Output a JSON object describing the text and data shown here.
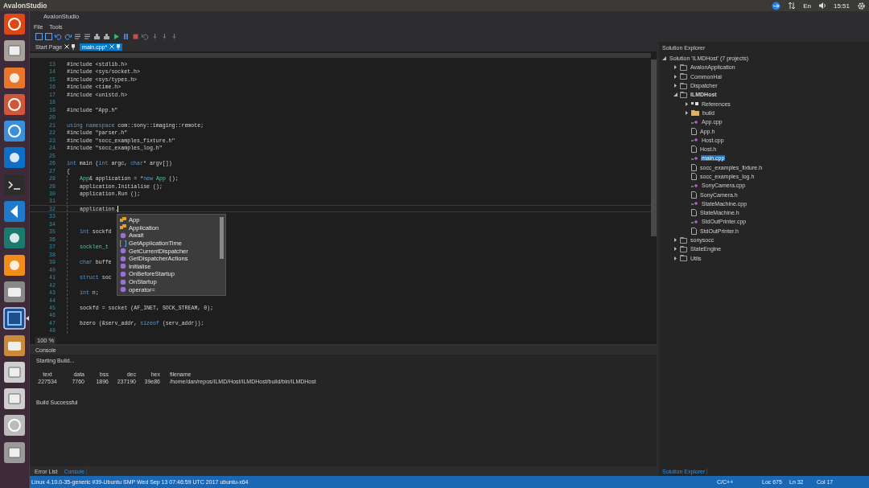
{
  "system_bar": {
    "title": "AvalonStudio",
    "language": "En",
    "time": "15:51"
  },
  "launcher": [
    {
      "kind": "ubuntu",
      "selected": false
    },
    {
      "kind": "files",
      "selected": false
    },
    {
      "kind": "store",
      "selected": false
    },
    {
      "kind": "settings",
      "selected": false
    },
    {
      "kind": "browser",
      "selected": false
    },
    {
      "kind": "remote",
      "selected": false
    },
    {
      "kind": "terminal",
      "selected": false
    },
    {
      "kind": "code",
      "selected": false
    },
    {
      "kind": "git",
      "selected": false
    },
    {
      "kind": "paint",
      "selected": false
    },
    {
      "kind": "camera",
      "selected": false
    },
    {
      "kind": "studio",
      "selected": true
    },
    {
      "kind": "photos",
      "selected": false
    },
    {
      "kind": "drive",
      "selected": false
    },
    {
      "kind": "drive",
      "selected": false
    },
    {
      "kind": "dvd",
      "selected": false
    },
    {
      "kind": "trash",
      "selected": false
    }
  ],
  "window": {
    "title": "AvalonStudio"
  },
  "menu": [
    "File",
    "Tools"
  ],
  "tabs": [
    {
      "label": "Start Page",
      "selected": false
    },
    {
      "label": "main.cpp*",
      "selected": true
    }
  ],
  "editor": {
    "zoom": "100 %",
    "lines": [
      {
        "number": "13",
        "indented": false,
        "current": false,
        "tokens": [
          {
            "text": "#include <stdlib.h>",
            "kind": "plain"
          }
        ]
      },
      {
        "number": "14",
        "indented": false,
        "current": false,
        "tokens": [
          {
            "text": "#include <sys/socket.h>",
            "kind": "plain"
          }
        ]
      },
      {
        "number": "15",
        "indented": false,
        "current": false,
        "tokens": [
          {
            "text": "#include <sys/types.h>",
            "kind": "plain"
          }
        ]
      },
      {
        "number": "16",
        "indented": false,
        "current": false,
        "tokens": [
          {
            "text": "#include <time.h>",
            "kind": "plain"
          }
        ]
      },
      {
        "number": "17",
        "indented": false,
        "current": false,
        "tokens": [
          {
            "text": "#include <unistd.h>",
            "kind": "plain"
          }
        ]
      },
      {
        "number": "18",
        "indented": false,
        "current": false
      },
      {
        "number": "19",
        "indented": false,
        "current": false,
        "tokens": [
          {
            "text": "#include \"App.h\"",
            "kind": "plain"
          }
        ]
      },
      {
        "number": "20",
        "indented": false,
        "current": false
      },
      {
        "number": "21",
        "indented": false,
        "current": false,
        "tokens": [
          {
            "text": "using namespace",
            "kind": "keyword"
          },
          {
            "text": " com::sony::imaging::remote;",
            "kind": "plain"
          }
        ]
      },
      {
        "number": "22",
        "indented": false,
        "current": false,
        "tokens": [
          {
            "text": "#include \"parser.h\"",
            "kind": "plain"
          }
        ]
      },
      {
        "number": "23",
        "indented": false,
        "current": false,
        "tokens": [
          {
            "text": "#include \"socc_examples_fixture.h\"",
            "kind": "plain"
          }
        ]
      },
      {
        "number": "24",
        "indented": false,
        "current": false,
        "tokens": [
          {
            "text": "#include \"socc_examples_log.h\"",
            "kind": "plain"
          }
        ]
      },
      {
        "number": "25",
        "indented": false,
        "current": false
      },
      {
        "number": "26",
        "indented": false,
        "current": false,
        "tokens": [
          {
            "text": "int",
            "kind": "keyword"
          },
          {
            "text": " main (",
            "kind": "plain"
          },
          {
            "text": "int",
            "kind": "keyword"
          },
          {
            "text": " argc, ",
            "kind": "plain"
          },
          {
            "text": "char",
            "kind": "keyword"
          },
          {
            "text": "* argv[])",
            "kind": "plain"
          }
        ]
      },
      {
        "number": "27",
        "indented": false,
        "current": false,
        "tokens": [
          {
            "text": "{",
            "kind": "plain"
          }
        ]
      },
      {
        "number": "28",
        "indented": true,
        "current": false,
        "tokens": [
          {
            "text": "App",
            "kind": "type"
          },
          {
            "text": "& application = *",
            "kind": "plain"
          },
          {
            "text": "new",
            "kind": "keyword"
          },
          {
            "text": " App",
            "kind": "type"
          },
          {
            "text": " ();",
            "kind": "plain"
          }
        ]
      },
      {
        "number": "29",
        "indented": true,
        "current": false,
        "tokens": [
          {
            "text": "application.Initialise ();",
            "kind": "plain"
          }
        ]
      },
      {
        "number": "30",
        "indented": true,
        "current": false,
        "tokens": [
          {
            "text": "application.Run ();",
            "kind": "plain"
          }
        ]
      },
      {
        "number": "31",
        "indented": true,
        "current": false
      },
      {
        "number": "32",
        "indented": true,
        "current": true,
        "tokens": [
          {
            "text": "application.",
            "kind": "plain"
          }
        ]
      },
      {
        "number": "33",
        "indented": true,
        "current": false
      },
      {
        "number": "34",
        "indented": true,
        "current": false
      },
      {
        "number": "35",
        "indented": true,
        "current": false,
        "tokens": [
          {
            "text": "int",
            "kind": "keyword"
          },
          {
            "text": " sockfd",
            "kind": "plain"
          }
        ]
      },
      {
        "number": "36",
        "indented": true,
        "current": false
      },
      {
        "number": "37",
        "indented": true,
        "current": false,
        "tokens": [
          {
            "text": "socklen_t",
            "kind": "type"
          }
        ]
      },
      {
        "number": "38",
        "indented": true,
        "current": false
      },
      {
        "number": "39",
        "indented": true,
        "current": false,
        "tokens": [
          {
            "text": "char",
            "kind": "keyword"
          },
          {
            "text": " buffe",
            "kind": "plain"
          }
        ]
      },
      {
        "number": "40",
        "indented": true,
        "current": false
      },
      {
        "number": "41",
        "indented": true,
        "current": false,
        "tokens": [
          {
            "text": "struct",
            "kind": "keyword"
          },
          {
            "text": " soc",
            "kind": "plain"
          }
        ]
      },
      {
        "number": "42",
        "indented": true,
        "current": false
      },
      {
        "number": "43",
        "indented": true,
        "current": false,
        "tokens": [
          {
            "text": "int",
            "kind": "keyword"
          },
          {
            "text": " n;",
            "kind": "plain"
          }
        ]
      },
      {
        "number": "44",
        "indented": true,
        "current": false
      },
      {
        "number": "45",
        "indented": true,
        "current": false,
        "tokens": [
          {
            "text": "sockfd = socket (AF_INET, SOCK_STREAM, 0);",
            "kind": "plain"
          }
        ]
      },
      {
        "number": "46",
        "indented": true,
        "current": false
      },
      {
        "number": "47",
        "indented": true,
        "current": false,
        "tokens": [
          {
            "text": "bzero (&serv_addr, ",
            "kind": "plain"
          },
          {
            "text": "sizeof",
            "kind": "keyword"
          },
          {
            "text": " (serv_addr));",
            "kind": "plain"
          }
        ]
      },
      {
        "number": "48",
        "indented": true,
        "current": false
      }
    ]
  },
  "completion": [
    {
      "label": "App",
      "kind": "class"
    },
    {
      "label": "Application",
      "kind": "class"
    },
    {
      "label": "Await",
      "kind": "method"
    },
    {
      "label": "GetApplicationTime",
      "kind": "field"
    },
    {
      "label": "GetCurrentDispatcher",
      "kind": "method"
    },
    {
      "label": "GetDispatcherActions",
      "kind": "method"
    },
    {
      "label": "Initialise",
      "kind": "method"
    },
    {
      "label": "OnBeforeStartup",
      "kind": "method"
    },
    {
      "label": "OnStartup",
      "kind": "method"
    },
    {
      "label": "operator=",
      "kind": "method"
    }
  ],
  "console": {
    "title": "Console",
    "status": "Starting Build...",
    "columns": [
      "text",
      "data",
      "bss",
      "dec",
      "hex",
      "filename"
    ],
    "row": [
      "227534",
      "7760",
      "1896",
      "237190",
      "39e86",
      "/home/dan/repos/ILMD/Host/ILMDHost/build/bin/ILMDHost"
    ],
    "result": "Build Successful"
  },
  "bottom_tabs": [
    {
      "label": "Error List",
      "selected": false
    },
    {
      "label": "Console",
      "selected": true
    }
  ],
  "solution_explorer": {
    "title": "Solution Explorer",
    "tab": "Solution Explorer",
    "tree": [
      {
        "label": "Solution 'ILMDHost' (7 projects)",
        "expanded": true,
        "selected": false,
        "children": [
          {
            "label": "AvalonApplication",
            "kind": "project",
            "expanded": false,
            "selected": false
          },
          {
            "label": "CommonHal",
            "kind": "project",
            "expanded": false,
            "selected": false
          },
          {
            "label": "Dispatcher",
            "kind": "project",
            "expanded": false,
            "selected": false
          },
          {
            "label": "ILMDHost",
            "kind": "project",
            "expanded": true,
            "selected": false,
            "children": [
              {
                "label": "References",
                "kind": "references",
                "expanded": false,
                "selected": false
              },
              {
                "label": "build",
                "kind": "folder",
                "expanded": false,
                "selected": false
              },
              {
                "label": "App.cpp",
                "kind": "source",
                "selected": false
              },
              {
                "label": "App.h",
                "kind": "header",
                "selected": false
              },
              {
                "label": "Host.cpp",
                "kind": "source",
                "selected": false
              },
              {
                "label": "Host.h",
                "kind": "header",
                "selected": false
              },
              {
                "label": "main.cpp",
                "kind": "source",
                "selected": true
              },
              {
                "label": "socc_examples_fixture.h",
                "kind": "header",
                "selected": false
              },
              {
                "label": "socc_examples_log.h",
                "kind": "header",
                "selected": false
              },
              {
                "label": "SonyCamera.cpp",
                "kind": "source",
                "selected": false
              },
              {
                "label": "SonyCamera.h",
                "kind": "header",
                "selected": false
              },
              {
                "label": "StateMachine.cpp",
                "kind": "source",
                "selected": false
              },
              {
                "label": "StateMachine.h",
                "kind": "header",
                "selected": false
              },
              {
                "label": "StdOutPrinter.cpp",
                "kind": "source",
                "selected": false
              },
              {
                "label": "StdOutPrinter.h",
                "kind": "header",
                "selected": false
              }
            ]
          },
          {
            "label": "sonysocc",
            "kind": "project",
            "expanded": false,
            "selected": false
          },
          {
            "label": "StateEngine",
            "kind": "project",
            "expanded": false,
            "selected": false
          },
          {
            "label": "Utils",
            "kind": "project",
            "expanded": false,
            "selected": false
          }
        ]
      }
    ]
  },
  "status_bar": {
    "system": "Linux 4.10.0-35-generic #39-Ubuntu SMP Wed Sep 13 07:46:59 UTC 2017 ubuntu-x64",
    "language": "C/C++",
    "location": "Loc 675",
    "line": "Ln 32",
    "column": "Col 17"
  }
}
